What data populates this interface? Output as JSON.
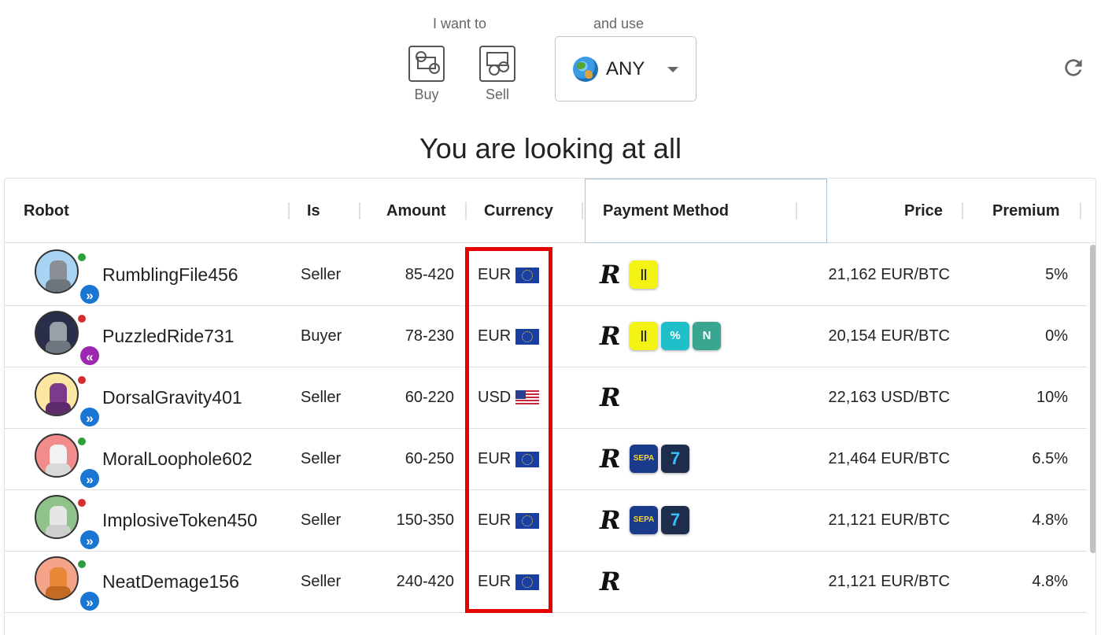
{
  "controls": {
    "want_label": "I want to",
    "buy_label": "Buy",
    "sell_label": "Sell",
    "use_label": "and use",
    "currency_value": "ANY"
  },
  "heading": "You are looking at all",
  "table": {
    "columns": [
      "Robot",
      "Is",
      "Amount",
      "Currency",
      "Payment Method",
      "Price",
      "Premium"
    ],
    "rows": [
      {
        "robot": "RumblingFile456",
        "is": "Seller",
        "amount": "85-420",
        "currency": "EUR",
        "flag": "eu-flag",
        "payments": [
          "revolut",
          "instant-sepa-yellow"
        ],
        "price": "21,162 EUR/BTC",
        "premium": "5%",
        "status": "online",
        "side": "seller"
      },
      {
        "robot": "PuzzledRide731",
        "is": "Buyer",
        "amount": "78-230",
        "currency": "EUR",
        "flag": "eu-flag",
        "payments": [
          "revolut",
          "instant-sepa-yellow",
          "teal-app",
          "n26"
        ],
        "price": "20,154 EUR/BTC",
        "premium": "0%",
        "status": "offline",
        "side": "buyer"
      },
      {
        "robot": "DorsalGravity401",
        "is": "Seller",
        "amount": "60-220",
        "currency": "USD",
        "flag": "us-flag",
        "payments": [
          "revolut"
        ],
        "price": "22,163 USD/BTC",
        "premium": "10%",
        "status": "offline",
        "side": "seller"
      },
      {
        "robot": "MoralLoophole602",
        "is": "Seller",
        "amount": "60-250",
        "currency": "EUR",
        "flag": "eu-flag",
        "payments": [
          "revolut",
          "sepa",
          "wise"
        ],
        "price": "21,464 EUR/BTC",
        "premium": "6.5%",
        "status": "online",
        "side": "seller"
      },
      {
        "robot": "ImplosiveToken450",
        "is": "Seller",
        "amount": "150-350",
        "currency": "EUR",
        "flag": "eu-flag",
        "payments": [
          "revolut",
          "sepa",
          "wise"
        ],
        "price": "21,121 EUR/BTC",
        "premium": "4.8%",
        "status": "offline",
        "side": "seller"
      },
      {
        "robot": "NeatDemage156",
        "is": "Seller",
        "amount": "240-420",
        "currency": "EUR",
        "flag": "eu-flag",
        "payments": [
          "revolut"
        ],
        "price": "21,121 EUR/BTC",
        "premium": "4.8%",
        "status": "online",
        "side": "seller"
      }
    ]
  },
  "pm_glyphs": {
    "revolut": "R",
    "sepa": "SEPA",
    "wise": "7",
    "n26": "N",
    "teal-app": "%",
    "instant-sepa-yellow": "||"
  },
  "colors": {
    "online": "#2e9e3f",
    "offline": "#d32f2f",
    "seller": "#1976d2",
    "buyer": "#9c27b0",
    "highlight": "#e60000"
  }
}
